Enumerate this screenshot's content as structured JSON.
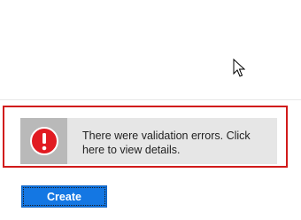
{
  "error_banner": {
    "icon": "error-exclamation-icon",
    "message": "There were validation errors. Click here to view details."
  },
  "actions": {
    "create_label": "Create"
  },
  "colors": {
    "error_red": "#e11b22",
    "highlight_frame": "#d11a1a",
    "primary_button": "#1477e3",
    "banner_background": "#e6e6e6",
    "icon_background": "#b9b9b9"
  }
}
